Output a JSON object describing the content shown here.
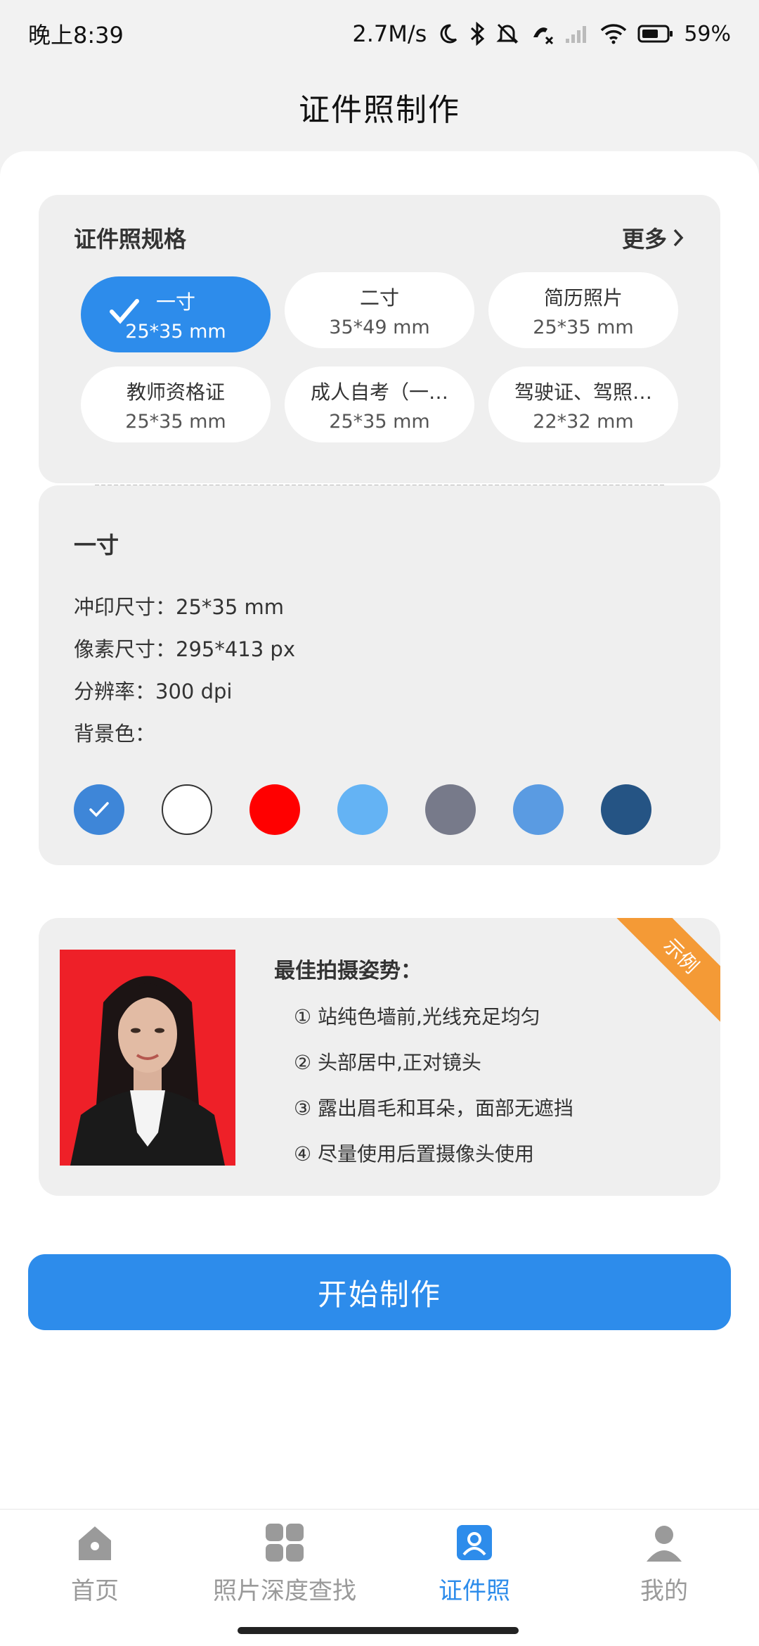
{
  "status_bar": {
    "time": "晚上8:39",
    "network_speed": "2.7M/s",
    "battery": "59%"
  },
  "page_title": "证件照制作",
  "spec_section": {
    "label": "证件照规格",
    "more": "更多",
    "options": [
      {
        "name": "一寸",
        "size": "25*35 mm",
        "selected": true
      },
      {
        "name": "二寸",
        "size": "35*49 mm",
        "selected": false
      },
      {
        "name": "简历照片",
        "size": "25*35 mm",
        "selected": false
      },
      {
        "name": "教师资格证",
        "size": "25*35 mm",
        "selected": false
      },
      {
        "name": "成人自考（一…",
        "size": "25*35 mm",
        "selected": false
      },
      {
        "name": "驾驶证、驾照…",
        "size": "22*32 mm",
        "selected": false
      }
    ]
  },
  "detail": {
    "title": "一寸",
    "print_size": "冲印尺寸：25*35 mm",
    "pixel_size": "像素尺寸：295*413 px",
    "resolution": "分辨率：300 dpi",
    "background_label": "背景色：",
    "colors": [
      {
        "hex": "#3e86d8",
        "selected": true
      },
      {
        "hex": "#ffffff",
        "selected": false
      },
      {
        "hex": "#ff0000",
        "selected": false
      },
      {
        "hex": "#64b3f4",
        "selected": false
      },
      {
        "hex": "#777a8a",
        "selected": false
      },
      {
        "hex": "#5a9be2",
        "selected": false
      },
      {
        "hex": "#255484",
        "selected": false
      }
    ]
  },
  "sample": {
    "badge": "示例",
    "tips_title": "最佳拍摄姿势：",
    "tips": [
      "① 站纯色墙前,光线充足均匀",
      "② 头部居中,正对镜头",
      "③ 露出眉毛和耳朵，面部无遮挡",
      "④ 尽量使用后置摄像头使用"
    ]
  },
  "start_button": "开始制作",
  "nav": {
    "items": [
      {
        "label": "首页",
        "icon": "home-icon",
        "active": false
      },
      {
        "label": "照片深度查找",
        "icon": "grid-icon",
        "active": false
      },
      {
        "label": "证件照",
        "icon": "id-photo-icon",
        "active": true
      },
      {
        "label": "我的",
        "icon": "profile-icon",
        "active": false
      }
    ]
  },
  "colors": {
    "primary": "#2d8ceb",
    "badge": "#f49a36",
    "sample_bg": "#ee2028"
  }
}
